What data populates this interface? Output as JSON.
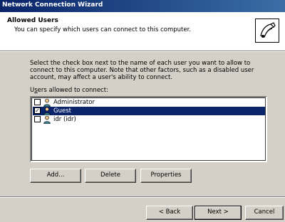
{
  "window": {
    "title": "Network Connection Wizard"
  },
  "header": {
    "title": "Allowed Users",
    "subtitle": "You can specify which users can connect to this computer."
  },
  "instructions": "Select the check box next to the name of each user you want to allow to connect to this computer.  Note that other factors, such as a disabled user account, may affect a user's ability to connect.",
  "list": {
    "label_pre": "U",
    "label_underlined": "s",
    "label_post": "ers allowed to connect:",
    "users": [
      {
        "name": "Administrator",
        "checked": false,
        "selected": false
      },
      {
        "name": "Guest",
        "checked": true,
        "selected": true
      },
      {
        "name": "idr (idr)",
        "checked": false,
        "selected": false
      }
    ]
  },
  "buttons": {
    "add": "Add...",
    "delete": "Delete",
    "properties": "Properties",
    "back": "< Back",
    "next": "Next >",
    "cancel": "Cancel"
  },
  "colors": {
    "selection": "#0a246a",
    "face": "#d4d0c8"
  }
}
